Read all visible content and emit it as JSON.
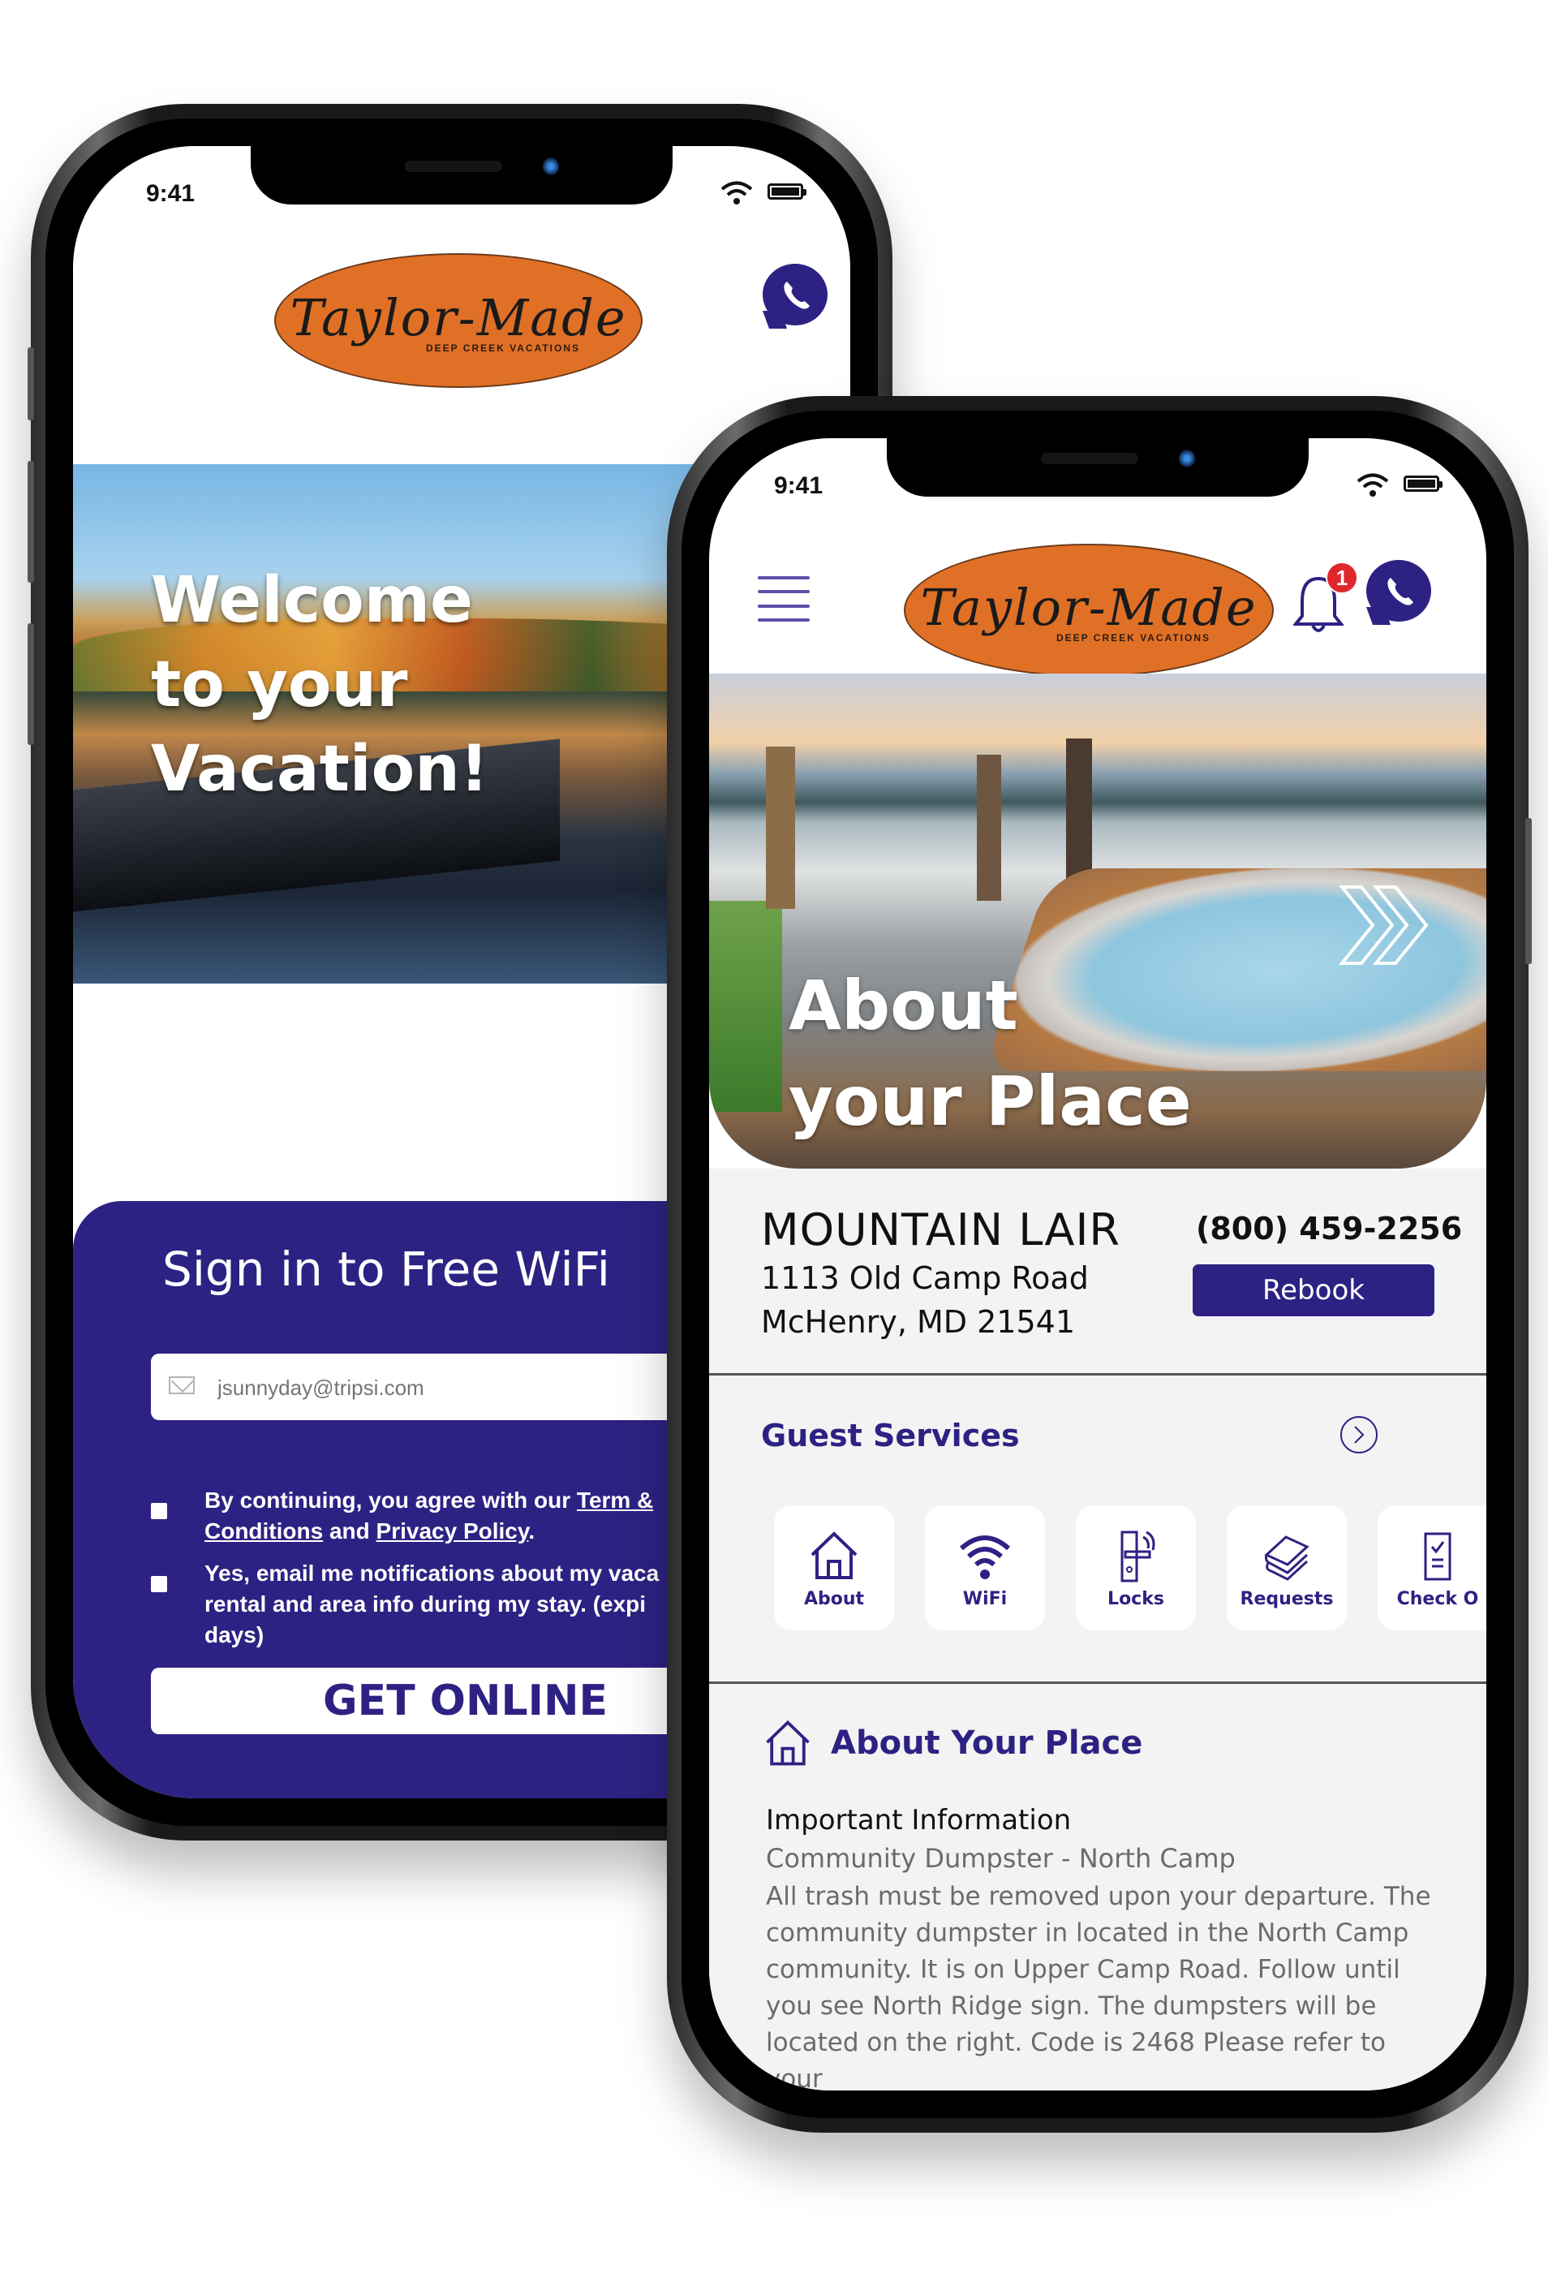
{
  "brand": {
    "logo_script": "Taylor-Made",
    "logo_sub": "DEEP CREEK VACATIONS",
    "accent_color": "#2d2283",
    "logo_color": "#e07026"
  },
  "wifi_screen": {
    "status_time": "9:41",
    "hero_lines": [
      "Welcome",
      "to your",
      "Vacation!"
    ],
    "panel_title": "Sign in to Free WiFi",
    "email_placeholder": "jsunnyday@tripsi.com",
    "consent": {
      "prefix": "By continuing, you agree with our ",
      "terms_link": "Term & Conditions",
      "middle": " and ",
      "privacy_link": "Privacy Policy",
      "suffix": ".",
      "line1": "By continuing, you agree with our",
      "line1_link": "Term &",
      "line2_link": "Conditions",
      "line2_and": " and ",
      "line2_privacy": "Privacy Policy",
      "line2_end": "."
    },
    "notifications_optin": {
      "line1": "Yes, email me notifications about my vaca",
      "line2": "rental and area info during my stay. (expi",
      "line3": "days)"
    },
    "get_online_label": "GET ONLINE"
  },
  "property_screen": {
    "status_time": "9:41",
    "notification_count": "1",
    "hero_lines": [
      "About",
      "your Place"
    ],
    "property": {
      "name": "MOUNTAIN LAIR",
      "address_line1": "1113 Old Camp Road",
      "address_line2": "McHenry, MD 21541",
      "phone": "(800) 459-2256",
      "rebook_label": "Rebook"
    },
    "guest_services": {
      "title": "Guest Services",
      "tiles": [
        {
          "label": "About",
          "icon": "house-icon"
        },
        {
          "label": "WiFi",
          "icon": "wifi-icon"
        },
        {
          "label": "Locks",
          "icon": "smart-lock-icon"
        },
        {
          "label": "Requests",
          "icon": "towels-icon"
        },
        {
          "label": "Check O",
          "icon": "checklist-icon"
        }
      ]
    },
    "about_section": {
      "title": "About Your Place",
      "important_title": "Important Information",
      "item_title": "Community Dumpster - North Camp",
      "item_body": "All trash must be removed upon your departure. The community dumpster in located in the North Camp community. It is on Upper Camp Road. Follow until you see North Ridge sign. The dumpsters will be located on the right. Code is 2468 Please refer to your"
    }
  }
}
